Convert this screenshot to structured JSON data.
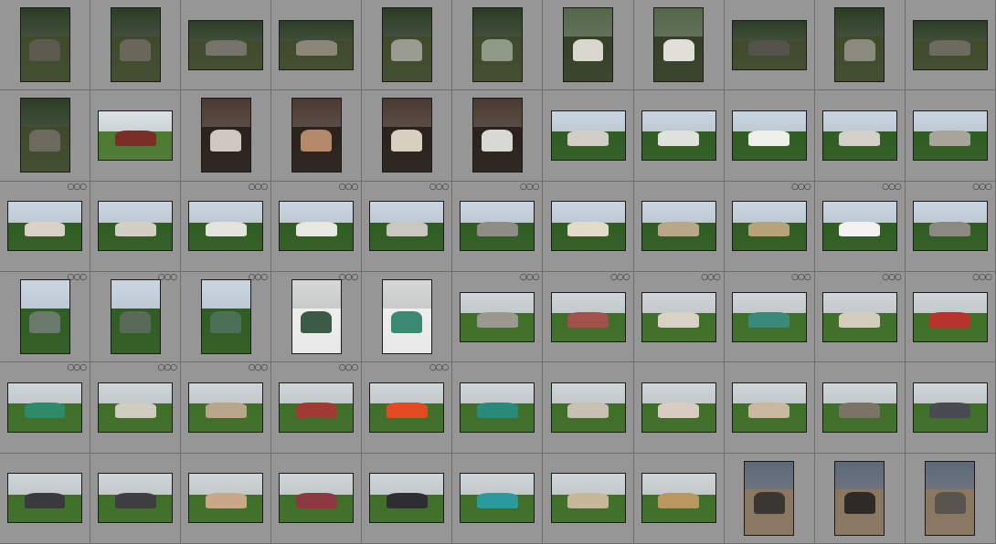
{
  "grid": {
    "columns": 11,
    "rows": 6
  },
  "badge_glyph": "○○○",
  "palette": {
    "forest": {
      "sky": "#2c3d24",
      "ground": "#3f4a2b",
      "subject": "#5d5f52"
    },
    "birch": {
      "sky": "#55674a",
      "ground": "#364027",
      "subject": "#c9cabf"
    },
    "interior": {
      "sky": "#4a3a31",
      "ground": "#2a211c",
      "subject": "#b8a68e"
    },
    "house": {
      "sky": "#d9e2e6",
      "ground": "#4d7a32",
      "subject": "#7a2e26"
    },
    "plane": {
      "sky": "#c9d6e2",
      "ground": "#2f5d22",
      "subject": "#d9d9d2"
    },
    "lawn": {
      "sky": "#cfd5d8",
      "ground": "#3e6f27",
      "subject": "#8c8c86"
    },
    "snow": {
      "sky": "#d6d8d8",
      "ground": "#eeeeee",
      "subject": "#3b5a48"
    },
    "beach": {
      "sky": "#5f6a78",
      "ground": "#8a7760",
      "subject": "#3b3b3b"
    }
  },
  "thumbnails": [
    {
      "orient": "portrait",
      "scene": "forest",
      "badge": false,
      "subject": "#5b5a4e"
    },
    {
      "orient": "portrait",
      "scene": "forest",
      "badge": false,
      "subject": "#6a665a"
    },
    {
      "orient": "landscape",
      "scene": "forest",
      "badge": false,
      "subject": "#76736a"
    },
    {
      "orient": "landscape",
      "scene": "forest",
      "badge": false,
      "subject": "#8a8778"
    },
    {
      "orient": "portrait",
      "scene": "forest",
      "badge": false,
      "subject": "#9a9c92"
    },
    {
      "orient": "portrait",
      "scene": "forest",
      "badge": false,
      "subject": "#8e9a86"
    },
    {
      "orient": "portrait",
      "scene": "birch",
      "badge": false,
      "subject": "#d8d8cf"
    },
    {
      "orient": "portrait",
      "scene": "birch",
      "badge": false,
      "subject": "#e0e0d8"
    },
    {
      "orient": "landscape",
      "scene": "forest",
      "badge": false,
      "subject": "#55544a"
    },
    {
      "orient": "portrait",
      "scene": "forest",
      "badge": false,
      "subject": "#8a8a7e"
    },
    {
      "orient": "landscape",
      "scene": "forest",
      "badge": false,
      "subject": "#6b6b60"
    },
    {
      "orient": "portrait",
      "scene": "forest",
      "badge": false,
      "subject": "#6a6a5e"
    },
    {
      "orient": "landscape",
      "scene": "house",
      "badge": false,
      "subject": "#7a2e26"
    },
    {
      "orient": "portrait",
      "scene": "interior",
      "badge": false,
      "subject": "#cfc8c0"
    },
    {
      "orient": "portrait",
      "scene": "interior",
      "badge": false,
      "subject": "#b58a6a"
    },
    {
      "orient": "portrait",
      "scene": "interior",
      "badge": false,
      "subject": "#d8cfc0"
    },
    {
      "orient": "portrait",
      "scene": "interior",
      "badge": false,
      "subject": "#d9d9d4"
    },
    {
      "orient": "landscape",
      "scene": "plane",
      "badge": false,
      "subject": "#cfcfc6"
    },
    {
      "orient": "landscape",
      "scene": "plane",
      "badge": false,
      "subject": "#e2e2dc"
    },
    {
      "orient": "landscape",
      "scene": "plane",
      "badge": false,
      "subject": "#f0f0ea"
    },
    {
      "orient": "landscape",
      "scene": "plane",
      "badge": false,
      "subject": "#d2d2ca"
    },
    {
      "orient": "landscape",
      "scene": "plane",
      "badge": false,
      "subject": "#a8a49a"
    },
    {
      "orient": "landscape",
      "scene": "plane",
      "badge": true,
      "subject": "#d8d2c6"
    },
    {
      "orient": "landscape",
      "scene": "plane",
      "badge": false,
      "subject": "#d4cfc4"
    },
    {
      "orient": "landscape",
      "scene": "plane",
      "badge": true,
      "subject": "#e4e4df"
    },
    {
      "orient": "landscape",
      "scene": "plane",
      "badge": true,
      "subject": "#e8e8e2"
    },
    {
      "orient": "landscape",
      "scene": "plane",
      "badge": true,
      "subject": "#c8c8c0"
    },
    {
      "orient": "landscape",
      "scene": "plane",
      "badge": true,
      "subject": "#8e8e86"
    },
    {
      "orient": "landscape",
      "scene": "plane",
      "badge": false,
      "subject": "#e0dcc8"
    },
    {
      "orient": "landscape",
      "scene": "plane",
      "badge": false,
      "subject": "#b8a88a"
    },
    {
      "orient": "landscape",
      "scene": "plane",
      "badge": true,
      "subject": "#b8a27a"
    },
    {
      "orient": "landscape",
      "scene": "plane",
      "badge": true,
      "subject": "#f2f2ee"
    },
    {
      "orient": "landscape",
      "scene": "plane",
      "badge": true,
      "subject": "#8a8a80"
    },
    {
      "orient": "portrait",
      "scene": "plane",
      "badge": true,
      "subject": "#6a7a6a"
    },
    {
      "orient": "portrait",
      "scene": "plane",
      "badge": true,
      "subject": "#5a6a58"
    },
    {
      "orient": "portrait",
      "scene": "plane",
      "badge": true,
      "subject": "#4a7058"
    },
    {
      "orient": "portrait",
      "scene": "snow",
      "badge": true,
      "subject": "#3b5a48"
    },
    {
      "orient": "portrait",
      "scene": "snow",
      "badge": false,
      "subject": "#3a8a72"
    },
    {
      "orient": "landscape",
      "scene": "lawn",
      "badge": true,
      "subject": "#9a9890"
    },
    {
      "orient": "landscape",
      "scene": "lawn",
      "badge": true,
      "subject": "#a0524a"
    },
    {
      "orient": "landscape",
      "scene": "lawn",
      "badge": true,
      "subject": "#d9d2c4"
    },
    {
      "orient": "landscape",
      "scene": "lawn",
      "badge": true,
      "subject": "#3a8a7a"
    },
    {
      "orient": "landscape",
      "scene": "lawn",
      "badge": true,
      "subject": "#d4cdbd"
    },
    {
      "orient": "landscape",
      "scene": "lawn",
      "badge": true,
      "subject": "#b8322c"
    },
    {
      "orient": "landscape",
      "scene": "lawn",
      "badge": true,
      "subject": "#2f8a6a"
    },
    {
      "orient": "landscape",
      "scene": "lawn",
      "badge": true,
      "subject": "#d0ccc0"
    },
    {
      "orient": "landscape",
      "scene": "lawn",
      "badge": true,
      "subject": "#b8a58a"
    },
    {
      "orient": "landscape",
      "scene": "lawn",
      "badge": true,
      "subject": "#a03a32"
    },
    {
      "orient": "landscape",
      "scene": "lawn",
      "badge": true,
      "subject": "#e24a22"
    },
    {
      "orient": "landscape",
      "scene": "lawn",
      "badge": false,
      "subject": "#2a8a7a"
    },
    {
      "orient": "landscape",
      "scene": "lawn",
      "badge": false,
      "subject": "#c8c0b0"
    },
    {
      "orient": "landscape",
      "scene": "lawn",
      "badge": false,
      "subject": "#d8cdc0"
    },
    {
      "orient": "landscape",
      "scene": "lawn",
      "badge": false,
      "subject": "#c8b8a0"
    },
    {
      "orient": "landscape",
      "scene": "lawn",
      "badge": false,
      "subject": "#7a7468"
    },
    {
      "orient": "landscape",
      "scene": "lawn",
      "badge": false,
      "subject": "#4a4a52"
    },
    {
      "orient": "landscape",
      "scene": "lawn",
      "badge": false,
      "subject": "#3a3a3e"
    },
    {
      "orient": "landscape",
      "scene": "lawn",
      "badge": false,
      "subject": "#3e3e40"
    },
    {
      "orient": "landscape",
      "scene": "lawn",
      "badge": false,
      "subject": "#c8a888"
    },
    {
      "orient": "landscape",
      "scene": "lawn",
      "badge": false,
      "subject": "#8a3a3e"
    },
    {
      "orient": "landscape",
      "scene": "lawn",
      "badge": false,
      "subject": "#2e2e30"
    },
    {
      "orient": "landscape",
      "scene": "lawn",
      "badge": false,
      "subject": "#2a9a9a"
    },
    {
      "orient": "landscape",
      "scene": "lawn",
      "badge": false,
      "subject": "#c8b89a"
    },
    {
      "orient": "landscape",
      "scene": "lawn",
      "badge": false,
      "subject": "#b8985e"
    },
    {
      "orient": "portrait",
      "scene": "beach",
      "badge": false,
      "subject": "#3a3632"
    },
    {
      "orient": "portrait",
      "scene": "beach",
      "badge": false,
      "subject": "#2e2a26"
    },
    {
      "orient": "portrait",
      "scene": "beach",
      "badge": false,
      "subject": "#5a5450"
    }
  ]
}
